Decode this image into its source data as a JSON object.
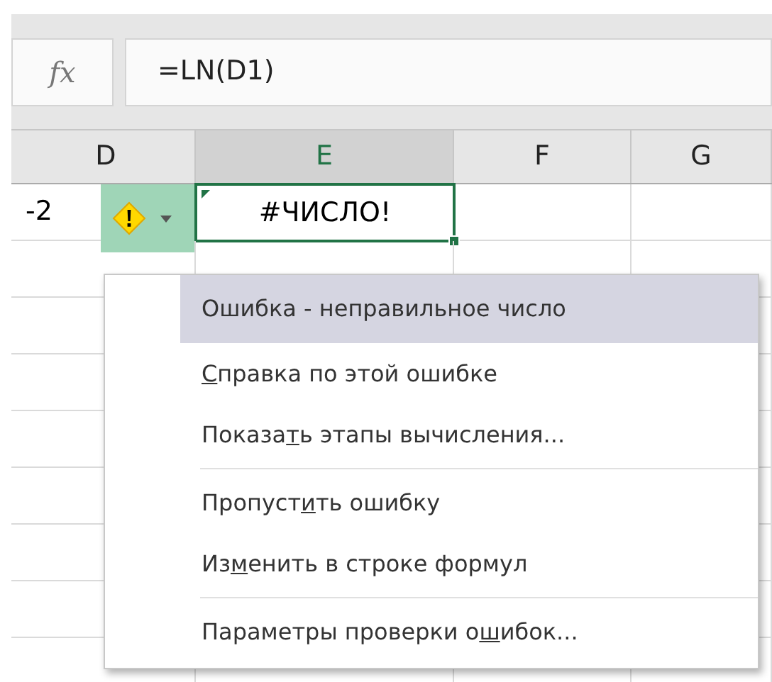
{
  "formula_bar": {
    "function_label": "fx",
    "formula": "=LN(D1)"
  },
  "columns": [
    {
      "label": "D",
      "selected": false
    },
    {
      "label": "E",
      "selected": true
    },
    {
      "label": "F",
      "selected": false
    },
    {
      "label": "G",
      "selected": false
    }
  ],
  "row": [
    {
      "value": "-2",
      "selected": false,
      "error": false
    },
    {
      "value": "#ЧИСЛО!",
      "selected": true,
      "error": true
    }
  ],
  "error_menu": {
    "items": [
      {
        "kind": "title",
        "before": "Ошибка - неправильное число",
        "selected": true,
        "separator_before": false
      },
      {
        "kind": "command",
        "key": "С",
        "after": "правка по этой ошибке",
        "selected": false,
        "separator_before": false
      },
      {
        "kind": "command",
        "before": "Показа",
        "key": "т",
        "after": "ь этапы вычисления...",
        "selected": false,
        "separator_before": false
      },
      {
        "kind": "command",
        "before": "Пропуст",
        "key": "и",
        "after": "ть ошибку",
        "selected": false,
        "separator_before": true
      },
      {
        "kind": "command",
        "before": "Из",
        "key": "м",
        "after": "енить в строке формул",
        "selected": false,
        "separator_before": false
      },
      {
        "kind": "command",
        "before": "Параметры проверки о",
        "key": "ш",
        "after": "ибок...",
        "selected": false,
        "separator_before": true
      }
    ]
  }
}
